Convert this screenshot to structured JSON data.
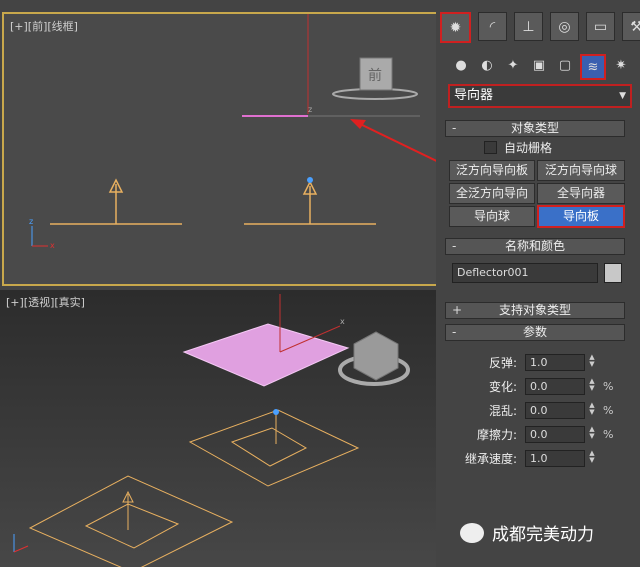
{
  "viewport_front": {
    "label": "[+][前][线框]",
    "gizmo_label": "前"
  },
  "viewport_persp": {
    "label": "[+][透视][真实]"
  },
  "command_panel": {
    "tabs": [
      "create-icon",
      "modify-icon",
      "hierarchy-icon",
      "motion-icon",
      "display-icon",
      "utilities-icon"
    ],
    "categories": [
      "geometry-icon",
      "shapes-icon",
      "lights-icon",
      "cameras-icon",
      "helpers-icon",
      "spacewarps-icon",
      "systems-icon"
    ],
    "dropdown_value": "导向器",
    "object_type": {
      "header": "对象类型",
      "autogrid": "自动栅格",
      "buttons": [
        "泛方向导向板",
        "泛方向导向球",
        "全泛方向导向",
        "全导向器",
        "导向球",
        "导向板"
      ]
    },
    "name_color": {
      "header": "名称和颜色",
      "name": "Deflector001"
    },
    "support_header": "支持对象类型",
    "params": {
      "header": "参数",
      "bounce_label": "反弹:",
      "bounce": "1.0",
      "variation_label": "变化:",
      "variation": "0.0",
      "chaos_label": "混乱:",
      "chaos": "0.0",
      "friction_label": "摩擦力:",
      "friction": "0.0",
      "inherit_label": "继承速度:",
      "inherit": "1.0",
      "percent": "%"
    }
  },
  "watermark": "成都完美动力",
  "colors": {
    "highlight": "#d02020",
    "selected": "#3a70c8",
    "viewport_border": "#c8a84c"
  }
}
